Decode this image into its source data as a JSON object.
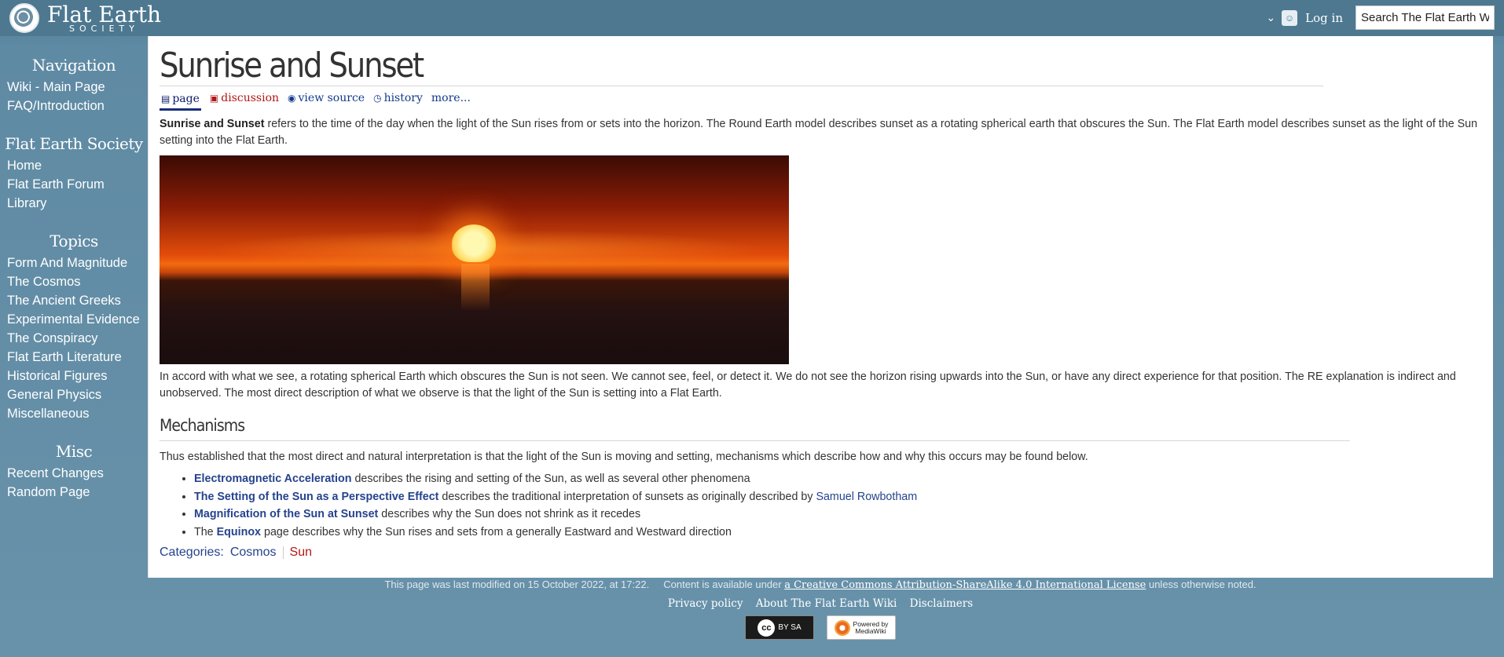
{
  "header": {
    "logo_title": "Flat Earth",
    "logo_subtitle": "SOCIETY",
    "login_label": "Log in",
    "search_placeholder": "Search The Flat Earth Wiki"
  },
  "sidebar": {
    "sections": [
      {
        "heading": "Navigation",
        "links": [
          "Wiki - Main Page",
          "FAQ/Introduction"
        ]
      },
      {
        "heading": "Flat Earth Society",
        "links": [
          "Home",
          "Flat Earth Forum",
          "Library"
        ]
      },
      {
        "heading": "Topics",
        "links": [
          "Form And Magnitude",
          "The Cosmos",
          "The Ancient Greeks",
          "Experimental Evidence",
          "The Conspiracy",
          "Flat Earth Literature",
          "Historical Figures",
          "General Physics",
          "Miscellaneous"
        ]
      },
      {
        "heading": "Misc",
        "links": [
          "Recent Changes",
          "Random Page"
        ]
      }
    ]
  },
  "page": {
    "title": "Sunrise and Sunset",
    "tabs": {
      "page": "page",
      "discussion": "discussion",
      "view_source": "view source",
      "history": "history",
      "more": "more..."
    },
    "intro_bold": "Sunrise and Sunset",
    "intro_rest": " refers to the time of the day when the light of the Sun rises from or sets into the horizon. The Round Earth model describes sunset as a rotating spherical earth that obscures the Sun. The Flat Earth model describes sunset as the light of the Sun setting into the Flat Earth.",
    "para2": "In accord with what we see, a rotating spherical Earth which obscures the Sun is not seen. We cannot see, feel, or detect it. We do not see the horizon rising upwards into the Sun, or have any direct experience for that position. The RE explanation is indirect and unobserved. The most direct description of what we observe is that the light of the Sun is setting into a Flat Earth.",
    "section_heading": "Mechanisms",
    "para3": "Thus established that the most direct and natural interpretation is that the light of the Sun is moving and setting, mechanisms which describe how and why this occurs may be found below.",
    "list": [
      {
        "link": "Electromagnetic Acceleration",
        "text": " describes the rising and setting of the Sun, as well as several other phenomena"
      },
      {
        "link": "The Setting of the Sun as a Perspective Effect",
        "text": " describes the traditional interpretation of sunsets as originally described by ",
        "link2": "Samuel Rowbotham"
      },
      {
        "link": "Magnification of the Sun at Sunset",
        "text": " describes why the Sun does not shrink as it recedes"
      },
      {
        "prefix": "The ",
        "link": "Equinox",
        "text": " page describes why the Sun rises and sets from a generally Eastward and Westward direction"
      }
    ],
    "categories_label": "Categories",
    "categories": [
      "Cosmos",
      "Sun"
    ]
  },
  "footer": {
    "modified": "This page was last modified on 15 October 2022, at 17:22.",
    "content_prefix": "Content is available under ",
    "license": "a Creative Commons Attribution-ShareAlike 4.0 International License",
    "content_suffix": " unless otherwise noted.",
    "links": [
      "Privacy policy",
      "About The Flat Earth Wiki",
      "Disclaimers"
    ],
    "cc_badge_text": "BY SA",
    "mw_badge_line1": "Powered by",
    "mw_badge_line2": "MediaWiki"
  }
}
